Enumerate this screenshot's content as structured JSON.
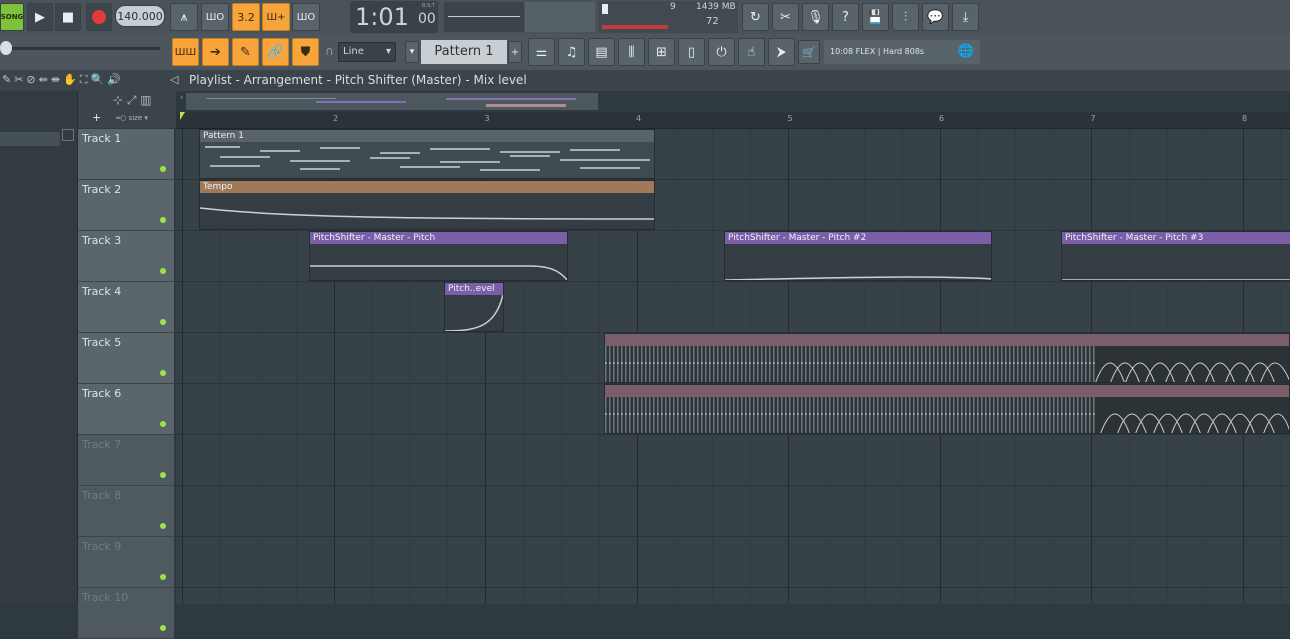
{
  "toolbar": {
    "song_mode": "SONG",
    "tempo": "140.000",
    "time_display": "1:01",
    "time_sub": "00",
    "time_unit": "B:S:T",
    "cpu_count": "9",
    "memory": "1439 MB",
    "polyphony": "72",
    "snap_mode": "Line",
    "pattern_selector": "Pattern 1",
    "news_text": "10:08 FLEX | Hard 808s"
  },
  "breadcrumb": "Playlist - Arrangement - Pitch Shifter (Master) - Mix level",
  "ruler": [
    "2",
    "3",
    "4",
    "5",
    "6",
    "7",
    "8"
  ],
  "tracks": [
    {
      "name": "Track 1"
    },
    {
      "name": "Track 2"
    },
    {
      "name": "Track 3"
    },
    {
      "name": "Track 4"
    },
    {
      "name": "Track 5"
    },
    {
      "name": "Track 6"
    },
    {
      "name": "Track 7"
    },
    {
      "name": "Track 8"
    },
    {
      "name": "Track 9"
    },
    {
      "name": "Track 10"
    }
  ],
  "clips": {
    "pattern": "Pattern 1",
    "tempo": "Tempo",
    "pitch1": "PitchShifter - Master - Pitch",
    "pitch2": "PitchShifter - Master - Pitch #2",
    "pitch3": "PitchShifter - Master - Pitch #3",
    "pitch_level": "Pitch..evel"
  },
  "colors": {
    "accent": "#f7a43a",
    "led": "#9fe34a",
    "tempo_clip": "#a0785a",
    "automation_clip": "#7b5ea8",
    "audio_clip": "#9c7a86"
  }
}
